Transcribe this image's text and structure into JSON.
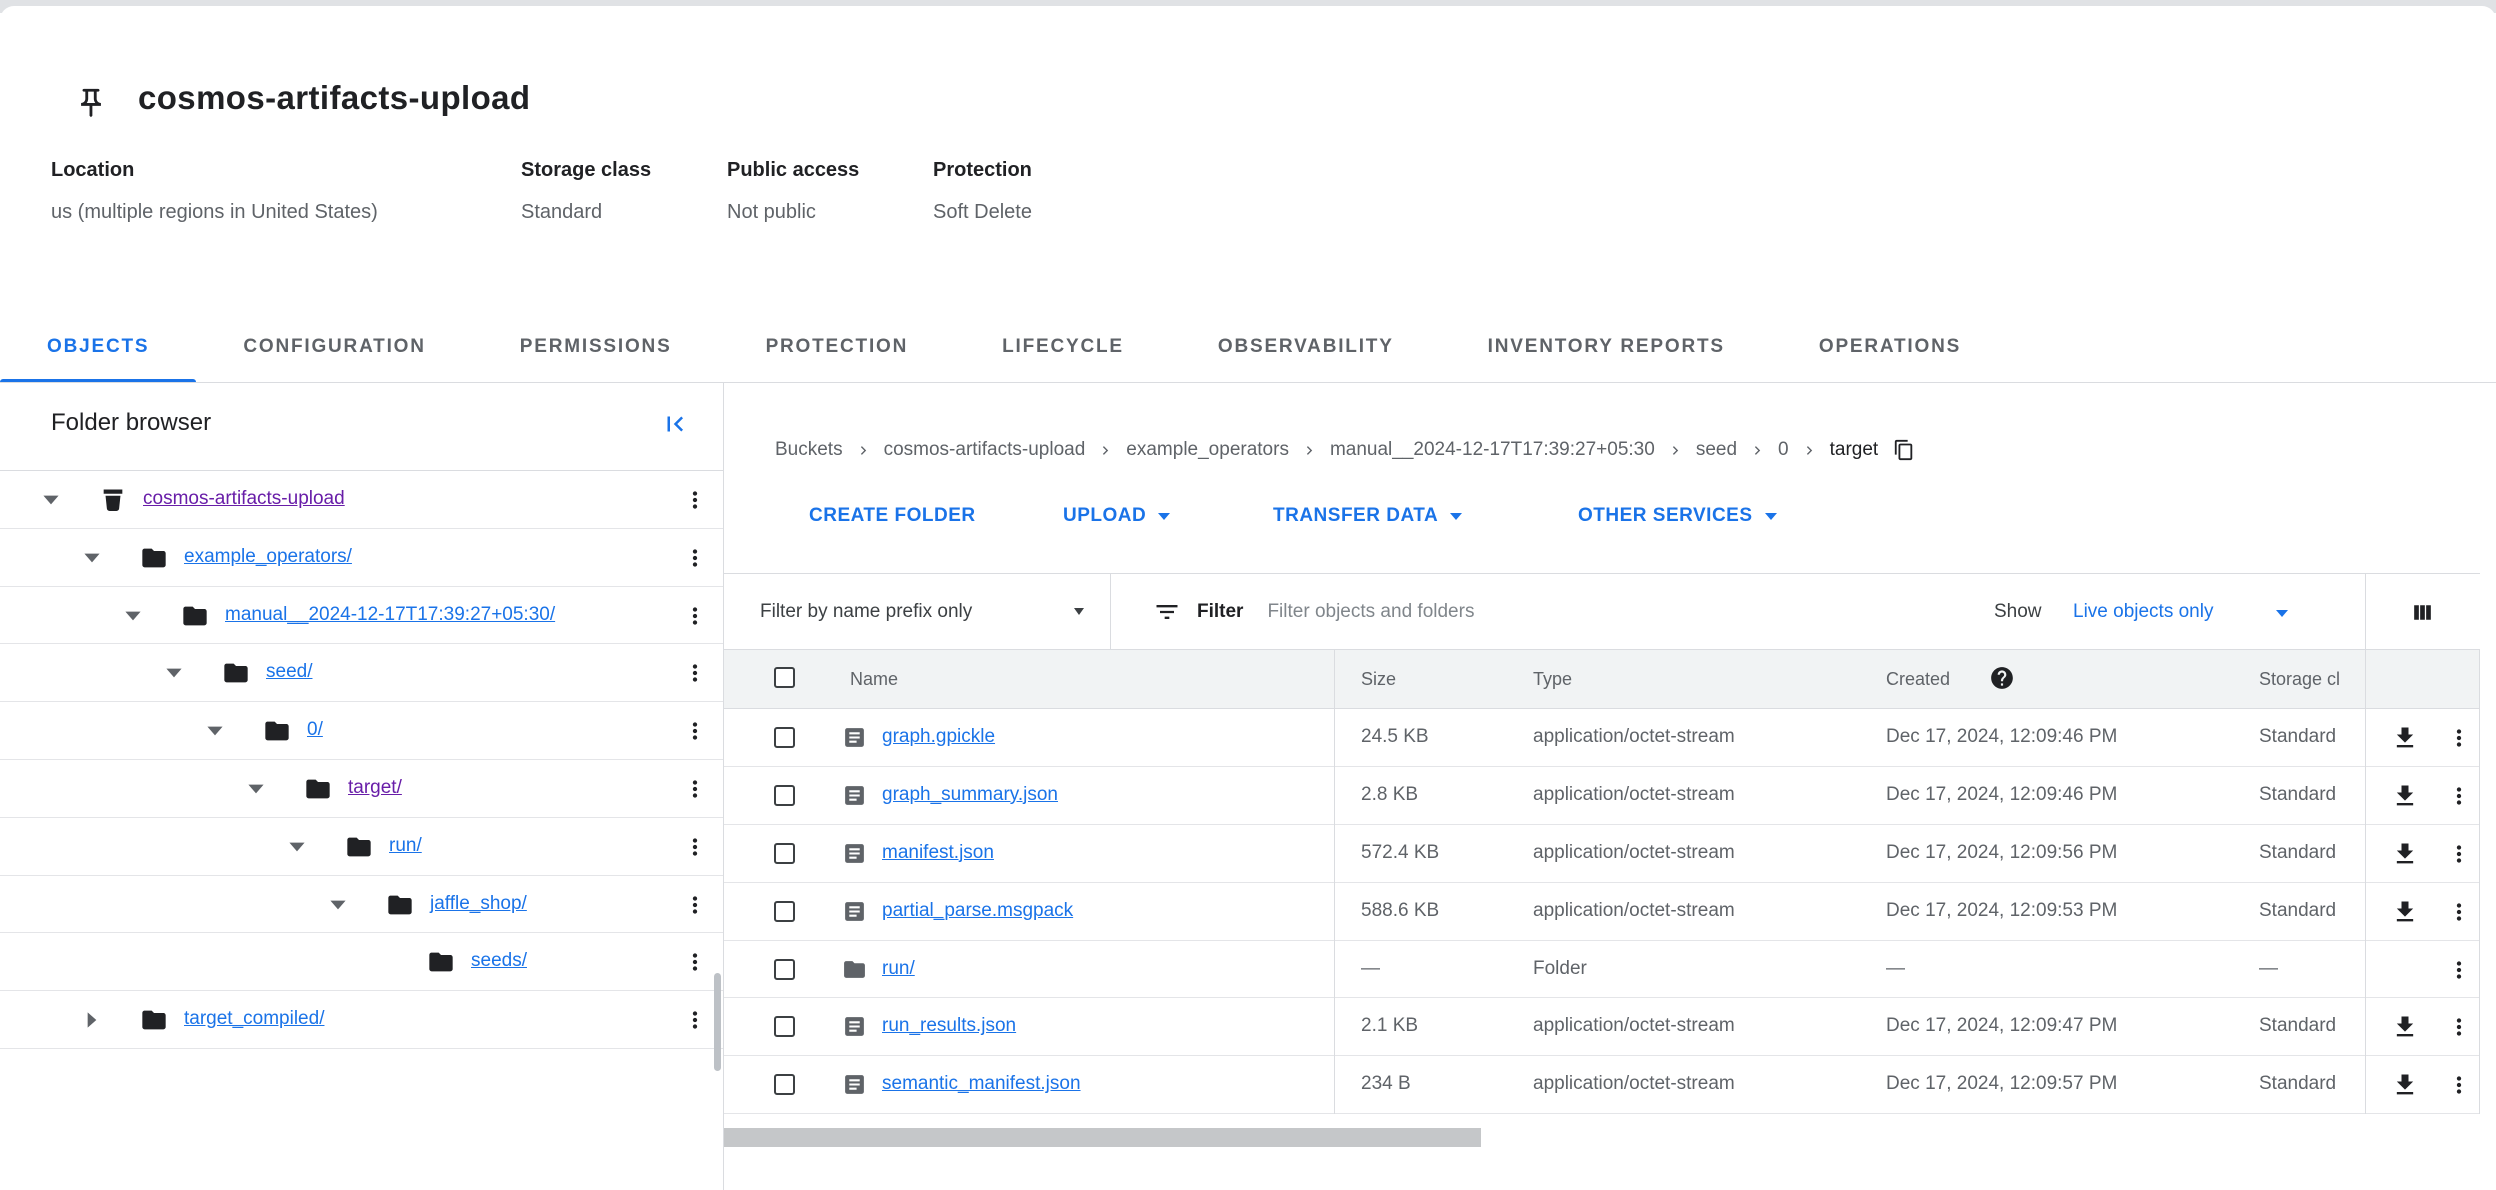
{
  "header": {
    "title": "cosmos-artifacts-upload",
    "meta": [
      {
        "label": "Location",
        "value": "us (multiple regions in United States)"
      },
      {
        "label": "Storage class",
        "value": "Standard"
      },
      {
        "label": "Public access",
        "value": "Not public"
      },
      {
        "label": "Protection",
        "value": "Soft Delete"
      }
    ]
  },
  "tabs": [
    {
      "label": "OBJECTS",
      "active": true
    },
    {
      "label": "CONFIGURATION",
      "active": false
    },
    {
      "label": "PERMISSIONS",
      "active": false
    },
    {
      "label": "PROTECTION",
      "active": false
    },
    {
      "label": "LIFECYCLE",
      "active": false
    },
    {
      "label": "OBSERVABILITY",
      "active": false
    },
    {
      "label": "INVENTORY REPORTS",
      "active": false
    },
    {
      "label": "OPERATIONS",
      "active": false
    }
  ],
  "folder_browser": {
    "title": "Folder browser",
    "tree": [
      {
        "name": "cosmos-artifacts-upload",
        "level": 0,
        "icon": "bucket",
        "state": "expanded",
        "visited": true
      },
      {
        "name": "example_operators/",
        "level": 1,
        "icon": "folder",
        "state": "expanded",
        "visited": false
      },
      {
        "name": "manual__2024-12-17T17:39:27+05:30/",
        "level": 2,
        "icon": "folder",
        "state": "expanded",
        "visited": false
      },
      {
        "name": "seed/",
        "level": 3,
        "icon": "folder",
        "state": "expanded",
        "visited": false
      },
      {
        "name": "0/",
        "level": 4,
        "icon": "folder",
        "state": "expanded",
        "visited": false
      },
      {
        "name": "target/",
        "level": 5,
        "icon": "folder",
        "state": "expanded",
        "visited": true
      },
      {
        "name": "run/",
        "level": 6,
        "icon": "folder",
        "state": "expanded",
        "visited": false
      },
      {
        "name": "jaffle_shop/",
        "level": 7,
        "icon": "folder",
        "state": "expanded",
        "visited": false
      },
      {
        "name": "seeds/",
        "level": 8,
        "icon": "folder",
        "state": "leaf",
        "visited": false
      },
      {
        "name": "target_compiled/",
        "level": 1,
        "icon": "folder",
        "state": "collapsed",
        "visited": false
      }
    ]
  },
  "main": {
    "breadcrumb": [
      "Buckets",
      "cosmos-artifacts-upload",
      "example_operators",
      "manual__2024-12-17T17:39:27+05:30",
      "seed",
      "0",
      "target"
    ],
    "actions": [
      {
        "label": "CREATE FOLDER",
        "caret": false
      },
      {
        "label": "UPLOAD",
        "caret": true
      },
      {
        "label": "TRANSFER DATA",
        "caret": true
      },
      {
        "label": "OTHER SERVICES",
        "caret": true
      }
    ],
    "filter_bar": {
      "prefix_label": "Filter by name prefix only",
      "filter_label": "Filter",
      "placeholder": "Filter objects and folders",
      "show_label": "Show",
      "show_value": "Live objects only"
    },
    "table": {
      "headers": {
        "name": "Name",
        "size": "Size",
        "type": "Type",
        "created": "Created",
        "storage": "Storage cl"
      },
      "rows": [
        {
          "name": "graph.gpickle",
          "icon": "file",
          "size": "24.5 KB",
          "type": "application/octet-stream",
          "created": "Dec 17, 2024, 12:09:46 PM",
          "storage": "Standard",
          "download": true
        },
        {
          "name": "graph_summary.json",
          "icon": "file",
          "size": "2.8 KB",
          "type": "application/octet-stream",
          "created": "Dec 17, 2024, 12:09:46 PM",
          "storage": "Standard",
          "download": true
        },
        {
          "name": "manifest.json",
          "icon": "file",
          "size": "572.4 KB",
          "type": "application/octet-stream",
          "created": "Dec 17, 2024, 12:09:56 PM",
          "storage": "Standard",
          "download": true
        },
        {
          "name": "partial_parse.msgpack",
          "icon": "file",
          "size": "588.6 KB",
          "type": "application/octet-stream",
          "created": "Dec 17, 2024, 12:09:53 PM",
          "storage": "Standard",
          "download": true
        },
        {
          "name": "run/",
          "icon": "folder",
          "size": "—",
          "type": "Folder",
          "created": "—",
          "storage": "—",
          "download": false
        },
        {
          "name": "run_results.json",
          "icon": "file",
          "size": "2.1 KB",
          "type": "application/octet-stream",
          "created": "Dec 17, 2024, 12:09:47 PM",
          "storage": "Standard",
          "download": true
        },
        {
          "name": "semantic_manifest.json",
          "icon": "file",
          "size": "234 B",
          "type": "application/octet-stream",
          "created": "Dec 17, 2024, 12:09:57 PM",
          "storage": "Standard",
          "download": true
        }
      ]
    }
  },
  "colors": {
    "link": "#1a73e8",
    "visited_link": "#681da8",
    "accent": "#1a73e8"
  }
}
